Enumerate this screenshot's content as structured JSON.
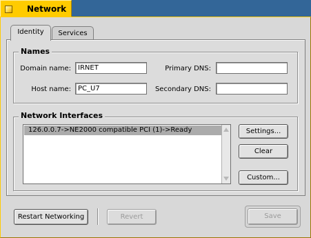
{
  "window": {
    "title": "Network"
  },
  "tabs": [
    {
      "label": "Identity"
    },
    {
      "label": "Services"
    }
  ],
  "names": {
    "title": "Names",
    "domain_label": "Domain name:",
    "domain_value": "IRNET",
    "host_label": "Host name:",
    "host_value": "PC_U7",
    "primary_dns_label": "Primary DNS:",
    "primary_dns_value": "",
    "secondary_dns_label": "Secondary DNS:",
    "secondary_dns_value": ""
  },
  "interfaces": {
    "title": "Network Interfaces",
    "items": [
      "126.0.0.7->NE2000 compatible PCI (1)->Ready"
    ],
    "settings_label": "Settings...",
    "clear_label": "Clear",
    "custom_label": "Custom..."
  },
  "footer": {
    "restart_label": "Restart Networking",
    "revert_label": "Revert",
    "save_label": "Save"
  },
  "colors": {
    "accent": "#ffcb00",
    "desktop": "#336698",
    "selection": "#ababab"
  }
}
